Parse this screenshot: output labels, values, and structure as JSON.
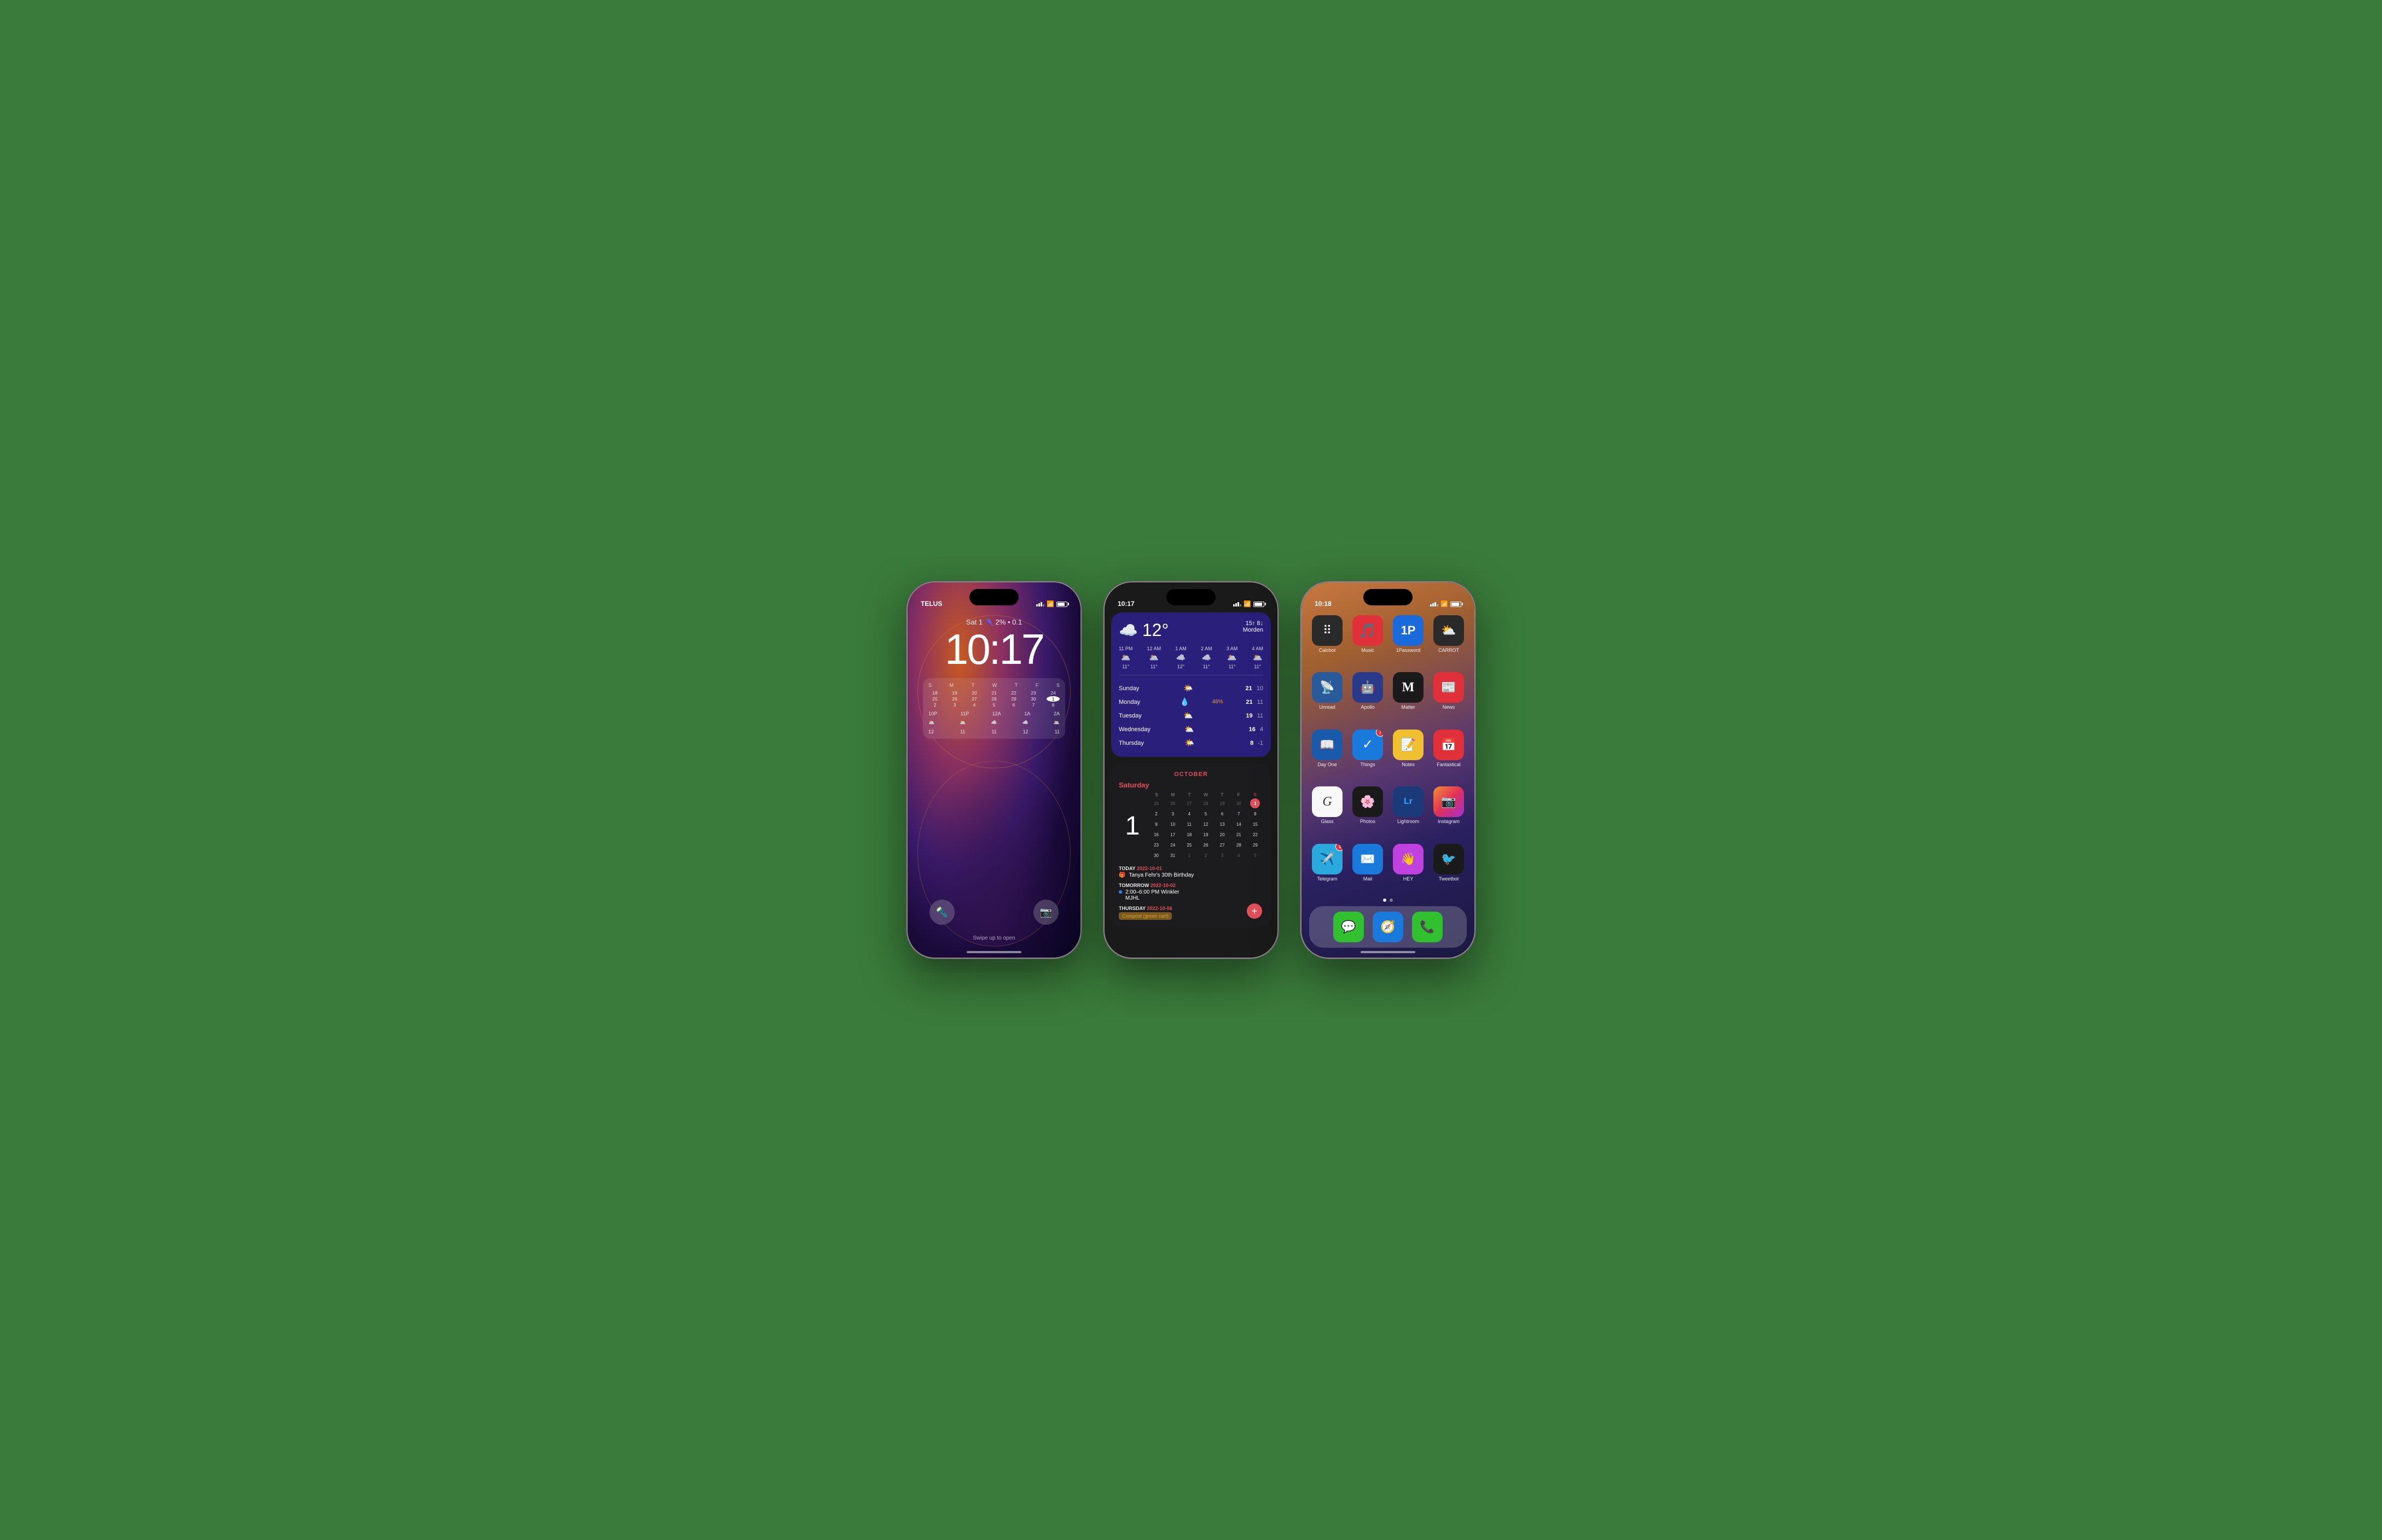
{
  "phone1": {
    "carrier": "TELUS",
    "time": "10:17",
    "date_line": "Sat 1 🌂 2% • 0.1",
    "swipe_text": "Swipe up to open",
    "calendar": {
      "header_days": [
        "S",
        "M",
        "T",
        "W",
        "T",
        "F",
        "S"
      ],
      "week1": [
        "18",
        "19",
        "20",
        "21",
        "22",
        "23",
        "24"
      ],
      "week2": [
        "25",
        "26",
        "27",
        "28",
        "29",
        "30",
        "1"
      ],
      "week3": [
        "2",
        "3",
        "4",
        "5",
        "6",
        "7",
        "8"
      ]
    },
    "weather_strip": {
      "times": [
        "10P",
        "11P",
        "12A",
        "1A",
        "2A"
      ],
      "temps": [
        "12",
        "11",
        "11",
        "12",
        "11"
      ]
    }
  },
  "phone2": {
    "carrier": "10:17",
    "weather": {
      "temp": "12°",
      "high_low": "15↑ 8↓",
      "location": "Morden",
      "icon": "☁️",
      "hours": [
        {
          "time": "11 PM",
          "icon": "🌥️",
          "temp": "11°"
        },
        {
          "time": "12 AM",
          "icon": "🌥️",
          "temp": "11°"
        },
        {
          "time": "1 AM",
          "icon": "☁️",
          "temp": "12°"
        },
        {
          "time": "2 AM",
          "icon": "☁️",
          "temp": "11°"
        },
        {
          "time": "3 AM",
          "icon": "🌥️",
          "temp": "11°"
        },
        {
          "time": "4 AM",
          "icon": "🌥️",
          "temp": "11°"
        }
      ],
      "days": [
        {
          "name": "Sunday",
          "icon": "🌤️",
          "rain": "",
          "hi": "21",
          "lo": "10"
        },
        {
          "name": "Monday",
          "icon": "💧",
          "rain": "46%",
          "hi": "21",
          "lo": "11"
        },
        {
          "name": "Tuesday",
          "icon": "⛅",
          "rain": "",
          "hi": "19",
          "lo": "11"
        },
        {
          "name": "Wednesday",
          "icon": "⛅",
          "rain": "",
          "hi": "16",
          "lo": "4"
        },
        {
          "name": "Thursday",
          "icon": "🌤️",
          "rain": "",
          "hi": "8",
          "lo": "-1"
        }
      ]
    },
    "calendar": {
      "month": "OCTOBER",
      "day_label": "Saturday",
      "big_day": "1",
      "day_headers": [
        "S",
        "M",
        "T",
        "W",
        "T",
        "F",
        "S"
      ],
      "weeks": [
        [
          "25",
          "26",
          "27",
          "28",
          "29",
          "30",
          "1"
        ],
        [
          "2",
          "3",
          "4",
          "5",
          "6",
          "7",
          "8"
        ],
        [
          "9",
          "10",
          "11",
          "12",
          "13",
          "14",
          "15"
        ],
        [
          "16",
          "17",
          "18",
          "19",
          "20",
          "21",
          "22"
        ],
        [
          "23",
          "24",
          "25",
          "26",
          "27",
          "28",
          "29"
        ],
        [
          "30",
          "31",
          "1",
          "2",
          "3",
          "4",
          "5"
        ]
      ],
      "events": [
        {
          "day_label": "TODAY",
          "date": "2022-10-01",
          "items": [
            {
              "dot_color": "",
              "icon": "🎁",
              "text": "Tanya Fehr's 30th Birthday"
            }
          ]
        },
        {
          "day_label": "TOMORROW",
          "date": "2022-10-02",
          "items": [
            {
              "dot_color": "#2a8af0",
              "icon": "",
              "text": "2:00–6:00 PM Winkler\nMJHL"
            }
          ]
        },
        {
          "day_label": "THURSDAY",
          "date": "2022-10-06",
          "items": [
            {
              "dot_color": "",
              "icon": "",
              "text": "Compost (green cart)",
              "tag": true
            }
          ]
        }
      ]
    }
  },
  "phone3": {
    "carrier": "10:18",
    "apps": [
      {
        "name": "Calcbot",
        "icon": "🧮",
        "bg": "calcbot",
        "emoji": "⠿"
      },
      {
        "name": "Music",
        "icon": "🎵",
        "bg": "music"
      },
      {
        "name": "1Password",
        "icon": "🔑",
        "bg": "1password"
      },
      {
        "name": "CARROT",
        "icon": "⚡",
        "bg": "carrot"
      },
      {
        "name": "Unread",
        "icon": "📡",
        "bg": "unread"
      },
      {
        "name": "Apollo",
        "icon": "🤖",
        "bg": "apollo"
      },
      {
        "name": "Matter",
        "icon": "M",
        "bg": "matter"
      },
      {
        "name": "News",
        "icon": "📰",
        "bg": "news"
      },
      {
        "name": "Day One",
        "icon": "📖",
        "bg": "dayone"
      },
      {
        "name": "Things",
        "icon": "✓",
        "bg": "things",
        "badge": "7"
      },
      {
        "name": "Notes",
        "icon": "📝",
        "bg": "notes"
      },
      {
        "name": "Fantastical",
        "icon": "📅",
        "bg": "fantastical"
      },
      {
        "name": "Glass",
        "icon": "G",
        "bg": "glass"
      },
      {
        "name": "Photos",
        "icon": "🌸",
        "bg": "photos"
      },
      {
        "name": "Lightroom",
        "icon": "Lr",
        "bg": "lightroom"
      },
      {
        "name": "Instagram",
        "icon": "📷",
        "bg": "instagram"
      },
      {
        "name": "Telegram",
        "icon": "✈️",
        "bg": "telegram",
        "badge": "1"
      },
      {
        "name": "Mail",
        "icon": "✉️",
        "bg": "mail"
      },
      {
        "name": "HEY",
        "icon": "👋",
        "bg": "hey"
      },
      {
        "name": "Tweetbot",
        "icon": "🐦",
        "bg": "tweetbot"
      }
    ],
    "dock": [
      {
        "name": "Messages",
        "icon": "💬",
        "bg": "messages"
      },
      {
        "name": "Safari",
        "icon": "🧭",
        "bg": "safari"
      },
      {
        "name": "Phone",
        "icon": "📞",
        "bg": "phone"
      }
    ],
    "page_dots": [
      true,
      false
    ]
  }
}
